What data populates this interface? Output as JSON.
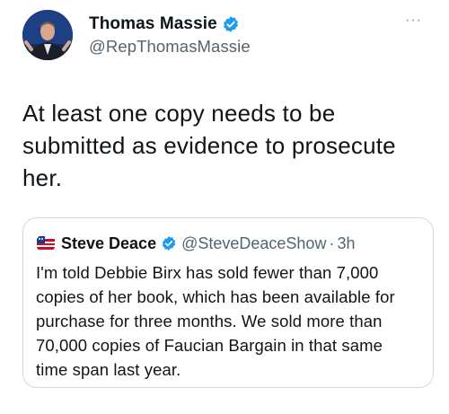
{
  "author": {
    "name": "Thomas Massie",
    "handle": "@RepThomasMassie",
    "verified": true
  },
  "more_label": "···",
  "tweet": {
    "text": "At least one copy needs to be\nsubmitted as evidence to prosecute\nher."
  },
  "quote": {
    "name": "Steve Deace",
    "handle": "@SteveDeaceShow",
    "separator": "·",
    "time": "3h",
    "verified": true,
    "text": "I'm told Debbie Birx has sold fewer than 7,000\ncopies of her book, which has been available for\npurchase for  three months. We sold more than\n70,000 copies of Faucian Bargain in that same\ntime span last year."
  },
  "colors": {
    "verified_blue": "#1d9bf0",
    "text_primary": "#0f1419",
    "text_secondary": "#536471",
    "border": "#cfd9de"
  },
  "icons": {
    "verified": "verified-badge-icon",
    "more": "more-icon"
  }
}
